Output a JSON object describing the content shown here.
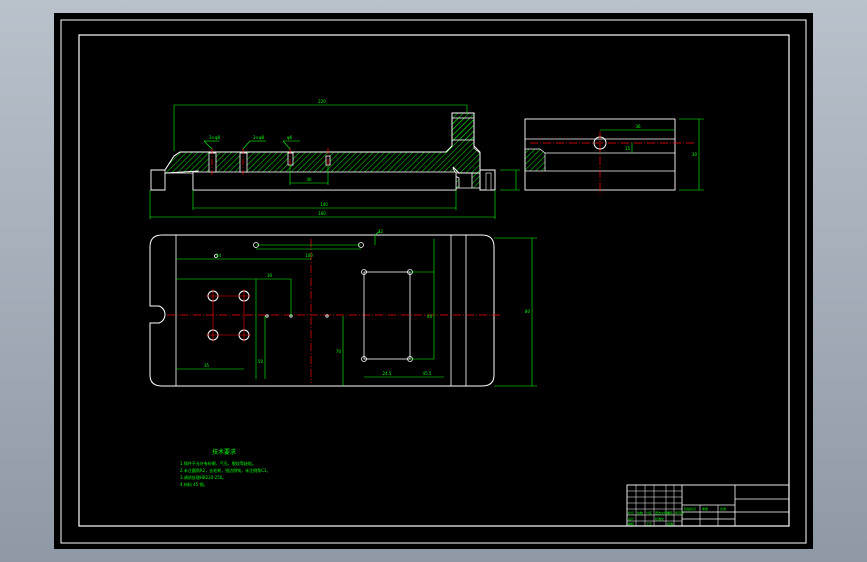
{
  "colors": {
    "background": "#000000",
    "frame": "#ffffff",
    "dimension": "#00ff00",
    "centerline": "#ff0000",
    "hatch": "#00ff00",
    "outline": "#ffffff",
    "viewport_bg": "#9aa3ad"
  },
  "drawing": {
    "dims": {
      "top_overall": "220",
      "top_hole1": "3×φ8",
      "top_hole2": "3×φ8",
      "top_hole3": "φ6",
      "top_inner": "40",
      "top_len": "140",
      "top_base": "160",
      "side_w": "36",
      "side_h": "30",
      "side_off": "15",
      "plan_a": "34",
      "plan_b": "100",
      "plan_c": "30",
      "plan_d": "35",
      "plan_e": "70",
      "plan_f": "50",
      "plan_g": "24.5",
      "plan_h": "45.5",
      "plan_i": "12",
      "plan_j": "80",
      "plan_k": "40"
    },
    "notes": {
      "title": "技术要求",
      "line1": "1.铸件不允许有砂眼、气孔、裂纹等缺陷。",
      "line2": "2.未注圆角R2，去毛刺，锐边倒钝，未注倒角C1。",
      "line3": "3.调质处理HB220-250。",
      "line4": "4.材料 45 钢。"
    },
    "title_block": {
      "c1": "标记",
      "c2": "处数",
      "c3": "分区",
      "c4": "更改文件号",
      "c5": "签名",
      "c6": "年月日",
      "d1": "设计",
      "d2": "标准化",
      "d3": "审核",
      "d4": "工艺",
      "d5": "批准",
      "s1": "阶段标记",
      "s2": "重量",
      "s3": "比例"
    }
  }
}
